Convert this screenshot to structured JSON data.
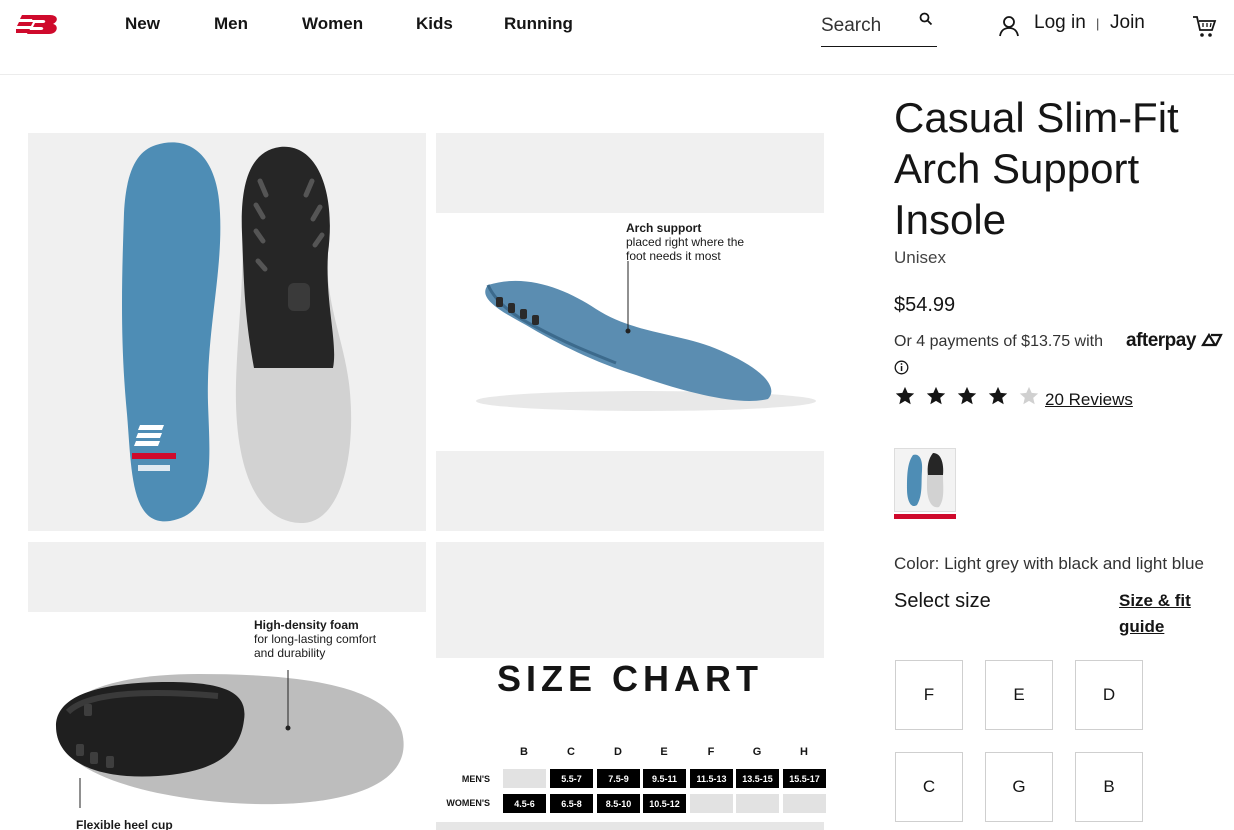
{
  "header": {
    "nav": [
      "New",
      "Men",
      "Women",
      "Kids",
      "Running"
    ],
    "search_placeholder": "Search",
    "login": "Log in",
    "separator": "|",
    "join": "Join"
  },
  "gallery": {
    "arch_callout_title": "Arch support",
    "arch_callout_text": "placed right where the foot needs it most",
    "foam_callout_title": "High-density foam",
    "foam_callout_text": "for long-lasting comfort and durability",
    "heel_callout_title": "Flexible heel cup",
    "size_chart": {
      "title": "SIZE CHART",
      "columns": [
        "B",
        "C",
        "D",
        "E",
        "F",
        "G",
        "H"
      ],
      "rows": [
        {
          "label": "MEN'S",
          "cells": [
            "",
            "5.5-7",
            "7.5-9",
            "9.5-11",
            "11.5-13",
            "13.5-15",
            "15.5-17"
          ]
        },
        {
          "label": "WOMEN'S",
          "cells": [
            "4.5-6",
            "6.5-8",
            "8.5-10",
            "10.5-12",
            "",
            "",
            ""
          ]
        }
      ]
    }
  },
  "product": {
    "title": "Casual Slim-Fit Arch Support Insole",
    "gender": "Unisex",
    "price": "$54.99",
    "afterpay_text": "Or 4 payments of $13.75 with",
    "afterpay_brand": "afterpay",
    "rating": 4,
    "rating_max": 5,
    "reviews": "20 Reviews",
    "color_label": "Color: Light grey with black and light blue",
    "select_size_label": "Select size",
    "size_guide_label": "Size & fit guide",
    "sizes": [
      "F",
      "E",
      "D",
      "C",
      "G",
      "B"
    ]
  },
  "colors": {
    "brand_red": "#cf0a2c",
    "insole_blue": "#4e8db5",
    "text": "#151515"
  }
}
